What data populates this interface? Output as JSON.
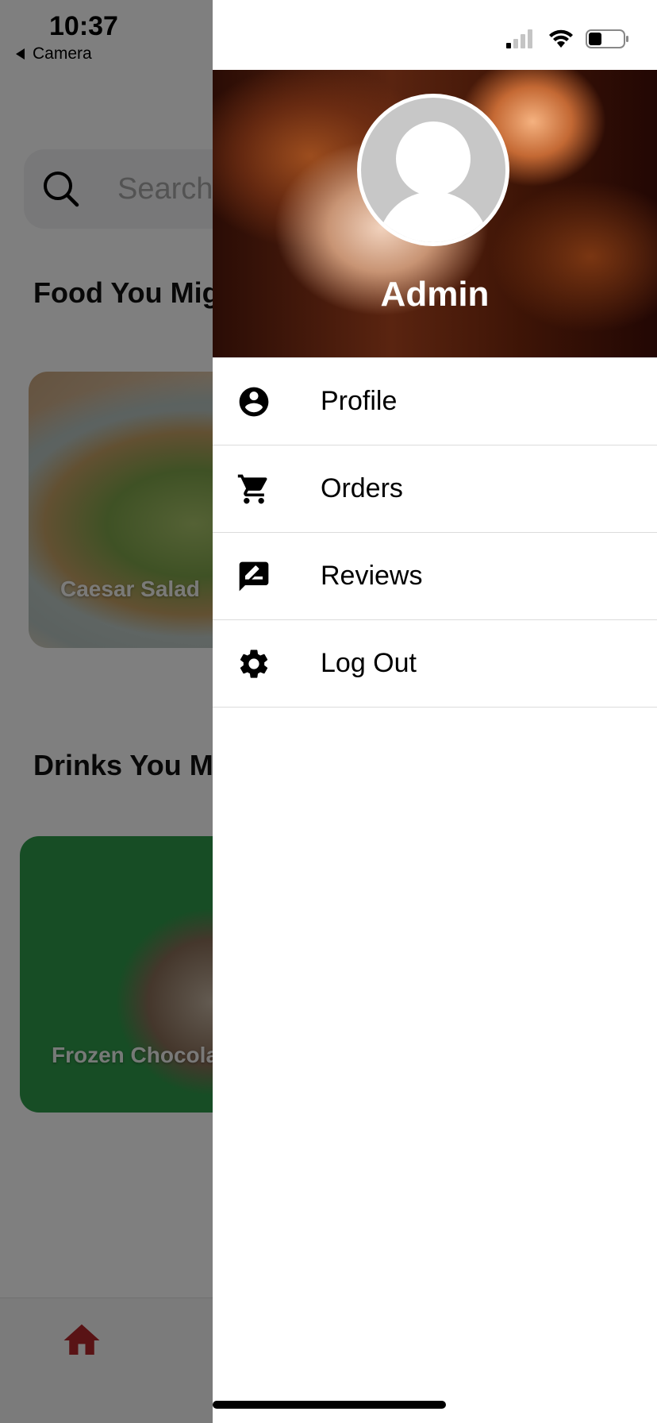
{
  "status_bar": {
    "time": "10:37",
    "back_label": "Camera"
  },
  "background": {
    "search_placeholder": "Search fo",
    "food_section_title": "Food You Mig",
    "food_card_label": "Caesar Salad",
    "drinks_section_title": "Drinks You M",
    "drink_card_label": "Frozen Chocola",
    "home_icon": "home-icon",
    "accent_color": "#b3262b"
  },
  "drawer": {
    "user_name": "Admin",
    "menu": [
      {
        "label": "Profile",
        "icon": "account-circle-icon"
      },
      {
        "label": "Orders",
        "icon": "cart-icon"
      },
      {
        "label": "Reviews",
        "icon": "rate-review-icon"
      },
      {
        "label": "Log Out",
        "icon": "gear-icon"
      }
    ]
  }
}
